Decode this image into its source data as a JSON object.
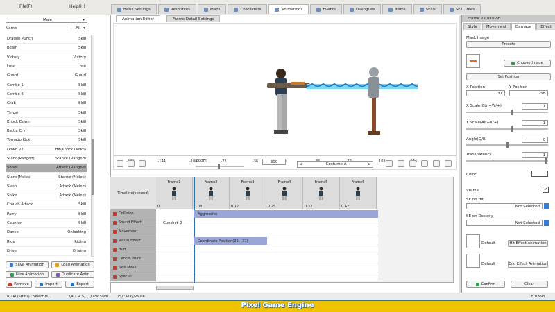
{
  "menu": {
    "file": "File(F)",
    "help": "Help(H)"
  },
  "tabs": [
    {
      "label": "Basic Settings"
    },
    {
      "label": "Resources"
    },
    {
      "label": "Maps"
    },
    {
      "label": "Characters"
    },
    {
      "label": "Animations"
    },
    {
      "label": "Events"
    },
    {
      "label": "Dialogues"
    },
    {
      "label": "Items"
    },
    {
      "label": "Skills"
    },
    {
      "label": "Skill Trees"
    }
  ],
  "left": {
    "filter_value": "Male",
    "column_name": "Name",
    "column_filter": "All",
    "items": [
      {
        "name": "Dragon Punch",
        "type": "Skill"
      },
      {
        "name": "Beam",
        "type": "Skill"
      },
      {
        "name": "Victory",
        "type": "Victory"
      },
      {
        "name": "Lose",
        "type": "Lose"
      },
      {
        "name": "Guard",
        "type": "Guard"
      },
      {
        "name": "Combo 1",
        "type": "Skill"
      },
      {
        "name": "Combo 2",
        "type": "Skill"
      },
      {
        "name": "Grab",
        "type": "Skill"
      },
      {
        "name": "Throw",
        "type": "Skill"
      },
      {
        "name": "Knock Down",
        "type": "Skill"
      },
      {
        "name": "Battle Cry",
        "type": "Skill"
      },
      {
        "name": "Tornado Kick",
        "type": "Skill"
      },
      {
        "name": "Down V2",
        "type": "Hit(Knock Down)"
      },
      {
        "name": "Stand(Ranged)",
        "type": "Stance (Ranged)"
      },
      {
        "name": "Shoot",
        "type": "Attack (Ranged)"
      },
      {
        "name": "Stand(Melee)",
        "type": "Stance (Melee)"
      },
      {
        "name": "Slash",
        "type": "Attack (Melee)"
      },
      {
        "name": "Spike",
        "type": "Attack (Melee)"
      },
      {
        "name": "Crouch Attack",
        "type": "Skill"
      },
      {
        "name": "Parry",
        "type": "Skill"
      },
      {
        "name": "Counter",
        "type": "Skill"
      },
      {
        "name": "Dance",
        "type": "Onlooking"
      },
      {
        "name": "Ride",
        "type": "Riding"
      },
      {
        "name": "Drive",
        "type": "Driving"
      }
    ],
    "buttons": {
      "save": "Save Animation",
      "load": "Load Animation",
      "new": "New Animation",
      "duplicate": "Duplicate Anim",
      "remove": "Remove",
      "import": "Import",
      "export": "Export"
    }
  },
  "center": {
    "subtabs": [
      "Animation Editor",
      "Frame Detail Settings"
    ],
    "ruler": [
      "-180",
      "-144",
      "-108",
      "-72",
      "-36",
      "0",
      "36",
      "72",
      "108",
      "144"
    ],
    "zoom_label": "Zoom",
    "zoom_value": "300",
    "costume": "Costume A",
    "timeline_header": "Timeline(second)",
    "frames": [
      {
        "label": "Frame1",
        "time": "0"
      },
      {
        "label": "Frame2",
        "time": "0.08"
      },
      {
        "label": "Frame3",
        "time": "0.17"
      },
      {
        "label": "Frame4",
        "time": "0.25"
      },
      {
        "label": "Frame5",
        "time": "0.33"
      },
      {
        "label": "Frame6",
        "time": "0.42"
      }
    ],
    "tracks": [
      "Collision",
      "Sound Effect",
      "Movement",
      "Visual Effect",
      "Buff",
      "Cancel Point",
      "Skill Mask",
      "Special"
    ],
    "clips": {
      "collision": "Aggressive",
      "sound": "Gunshot_2",
      "visual": "Coordinate Position(35, -37)"
    }
  },
  "right": {
    "title": "Frame 2 Collision",
    "tabs": [
      "Style",
      "Movement",
      "Damage",
      "Effect"
    ],
    "mask_image": "Mask Image",
    "presets": "Presets",
    "choose_image": "Choose Image",
    "set_position": "Set Position",
    "x_position_label": "X Position",
    "y_position_label": "Y Position",
    "x_position": "31",
    "y_position": "-58",
    "xscale_label": "X Scale(Ctrl+W/+)",
    "xscale": "1",
    "yscale_label": "Y Scale(Alt+X/+)",
    "yscale": "1",
    "angle_label": "Angle(Q/E)",
    "angle": "0",
    "transparency_label": "Transparency",
    "transparency": "1",
    "color_label": "Color",
    "visible_label": "Visible",
    "se_on_hit": "SE on Hit",
    "se_on_destroy": "SE on Destroy",
    "not_selected": "Not Selected",
    "default": "Default",
    "hit_effect_anim": "Hit Effect Animation",
    "end_effect_anim": "End Effect Animation",
    "confirm": "Confirm",
    "clear": "Clear"
  },
  "status": {
    "left": "(CTRL/SHIFT) : Select M...",
    "mid": "(ALT + S) : Quick Save",
    "play": "(S) : Play/Pause",
    "version": "DB 0.993"
  },
  "brand": {
    "title": "Pixel Game Engine"
  }
}
